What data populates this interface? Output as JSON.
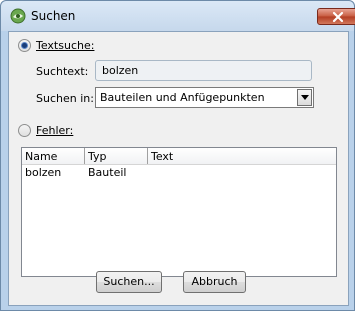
{
  "window": {
    "title": "Suchen"
  },
  "textsearch": {
    "radio_label": "Textsuche:",
    "selected": true,
    "searchtext_label": "Suchtext:",
    "searchtext_value": "bolzen",
    "searchin_label": "Suchen in:",
    "searchin_value": "Bauteilen und Anfügepunkten"
  },
  "errors": {
    "radio_label": "Fehler:",
    "selected": false
  },
  "results": {
    "columns": [
      "Name",
      "Typ",
      "Text"
    ],
    "rows": [
      {
        "name": "bolzen",
        "typ": "Bauteil",
        "text": ""
      }
    ]
  },
  "buttons": {
    "search": "Suchen...",
    "cancel": "Abbruch"
  },
  "colors": {
    "title_bg": "#c6d8ec",
    "close_button": "#c75a3f",
    "client_bg": "#f0f0f0"
  },
  "icons": {
    "app": "search-app-icon",
    "close": "close-icon",
    "dropdown": "chevron-down-icon"
  }
}
